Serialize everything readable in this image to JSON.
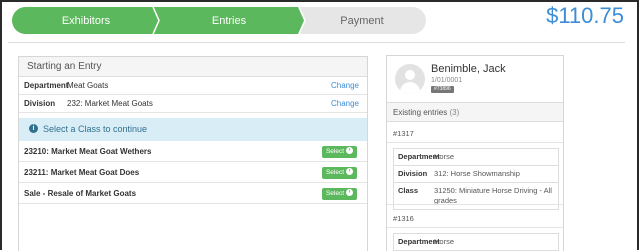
{
  "progress": {
    "steps": [
      {
        "label": "Exhibitors",
        "state": "complete"
      },
      {
        "label": "Entries",
        "state": "complete"
      },
      {
        "label": "Payment",
        "state": "pending"
      }
    ],
    "total": "$110.75"
  },
  "entry_panel": {
    "title": "Starting an Entry",
    "fields": [
      {
        "label": "Department",
        "value": "Meat Goats",
        "action": "Change"
      },
      {
        "label": "Division",
        "value": "232: Market Meat Goats",
        "action": "Change"
      }
    ],
    "notice": "Select a Class to continue",
    "classes": [
      {
        "name": "23210: Market Meat Goat Wethers",
        "button": "Select"
      },
      {
        "name": "23211: Market Meat Goat Does",
        "button": "Select"
      },
      {
        "name": "Sale - Resale of Market Goats",
        "button": "Select"
      }
    ]
  },
  "exhibitor": {
    "name": "Benimble, Jack",
    "date": "1/01/0001",
    "badge": "#73896",
    "existing_label": "Existing entries",
    "existing_count": "(3)",
    "entries": [
      {
        "id": "#1317",
        "rows": [
          {
            "key": "Department",
            "value": "Horse"
          },
          {
            "key": "Division",
            "value": "312: Horse Showmanship"
          },
          {
            "key": "Class",
            "value": "31250: Miniature Horse Driving - All grades"
          }
        ]
      },
      {
        "id": "#1316",
        "rows": [
          {
            "key": "Department",
            "value": "Horse"
          }
        ]
      }
    ]
  },
  "colors": {
    "accent_green": "#5cb85c",
    "accent_blue": "#3c8dd6",
    "info_bg": "#d9edf7"
  }
}
